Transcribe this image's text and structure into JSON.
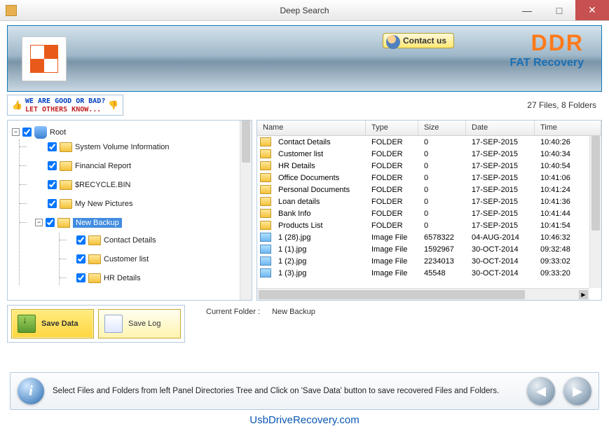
{
  "window": {
    "title": "Deep Search"
  },
  "header": {
    "contact_label": "Contact us",
    "brand": "DDR",
    "brand_sub": "FAT Recovery"
  },
  "feedback": {
    "line1": "WE ARE GOOD OR BAD?",
    "line2": "LET OTHERS KNOW..."
  },
  "stats": {
    "text": "27 Files, 8 Folders"
  },
  "tree": {
    "root": "Root",
    "children": [
      "System Volume Information",
      "Financial Report",
      "$RECYCLE.BIN",
      "My New Pictures",
      "New Backup"
    ],
    "selected": "New Backup",
    "sub": [
      "Contact Details",
      "Customer list",
      "HR Details"
    ]
  },
  "list": {
    "headers": {
      "name": "Name",
      "type": "Type",
      "size": "Size",
      "date": "Date",
      "time": "Time"
    },
    "rows": [
      {
        "icon": "folder",
        "name": "Contact Details",
        "type": "FOLDER",
        "size": "0",
        "date": "17-SEP-2015",
        "time": "10:40:26"
      },
      {
        "icon": "folder",
        "name": "Customer list",
        "type": "FOLDER",
        "size": "0",
        "date": "17-SEP-2015",
        "time": "10:40:34"
      },
      {
        "icon": "folder",
        "name": "HR Details",
        "type": "FOLDER",
        "size": "0",
        "date": "17-SEP-2015",
        "time": "10:40:54"
      },
      {
        "icon": "folder",
        "name": "Office Documents",
        "type": "FOLDER",
        "size": "0",
        "date": "17-SEP-2015",
        "time": "10:41:06"
      },
      {
        "icon": "folder",
        "name": "Personal Documents",
        "type": "FOLDER",
        "size": "0",
        "date": "17-SEP-2015",
        "time": "10:41:24"
      },
      {
        "icon": "folder",
        "name": "Loan details",
        "type": "FOLDER",
        "size": "0",
        "date": "17-SEP-2015",
        "time": "10:41:36"
      },
      {
        "icon": "folder",
        "name": "Bank Info",
        "type": "FOLDER",
        "size": "0",
        "date": "17-SEP-2015",
        "time": "10:41:44"
      },
      {
        "icon": "folder",
        "name": "Products List",
        "type": "FOLDER",
        "size": "0",
        "date": "17-SEP-2015",
        "time": "10:41:54"
      },
      {
        "icon": "image",
        "name": "1 (28).jpg",
        "type": "Image File",
        "size": "6578322",
        "date": "04-AUG-2014",
        "time": "10:46:32"
      },
      {
        "icon": "image",
        "name": "1 (1).jpg",
        "type": "Image File",
        "size": "1592967",
        "date": "30-OCT-2014",
        "time": "09:32:48"
      },
      {
        "icon": "image",
        "name": "1 (2).jpg",
        "type": "Image File",
        "size": "2234013",
        "date": "30-OCT-2014",
        "time": "09:33:02"
      },
      {
        "icon": "image",
        "name": "1 (3).jpg",
        "type": "Image File",
        "size": "45548",
        "date": "30-OCT-2014",
        "time": "09:33:20"
      }
    ]
  },
  "actions": {
    "save_data": "Save Data",
    "save_log": "Save Log",
    "current_label": "Current Folder :",
    "current_value": "New Backup"
  },
  "info": {
    "text": "Select Files and Folders from left Panel Directories Tree and Click on 'Save Data' button to save recovered Files and Folders."
  },
  "footer": {
    "link": "UsbDriveRecovery.com"
  }
}
